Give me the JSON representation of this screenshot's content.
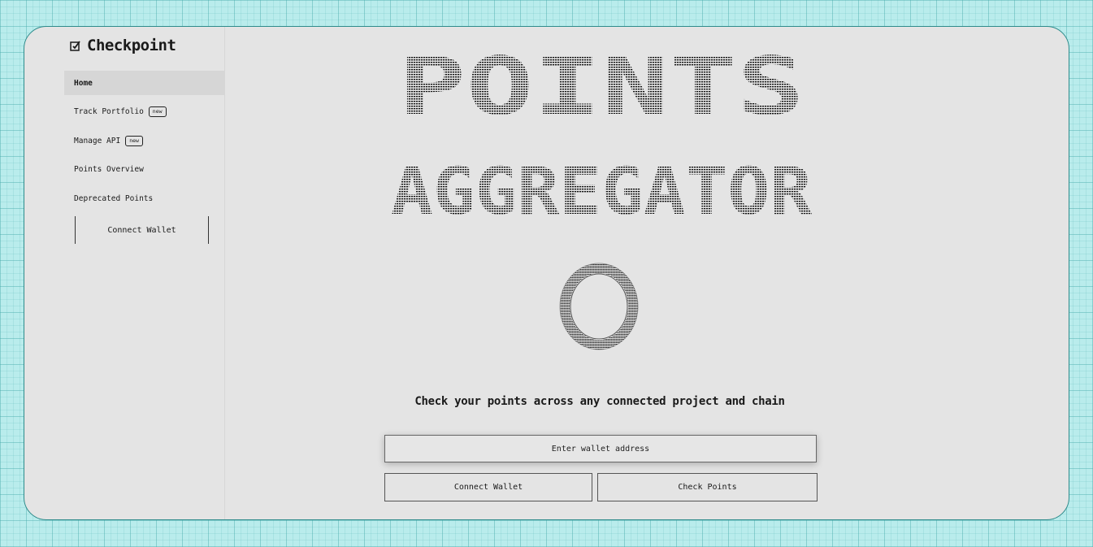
{
  "brand": {
    "name": "Checkpoint",
    "icon": "checkpoint-logo-icon"
  },
  "sidebar": {
    "items": [
      {
        "label": "Home",
        "active": true,
        "badge": ""
      },
      {
        "label": "Track Portfolio",
        "active": false,
        "badge": "new"
      },
      {
        "label": "Manage API",
        "active": false,
        "badge": "new"
      },
      {
        "label": "Points Overview",
        "active": false,
        "badge": ""
      },
      {
        "label": "Deprecated Points",
        "active": false,
        "badge": ""
      }
    ],
    "connect_label": "Connect Wallet"
  },
  "hero": {
    "art_words": [
      "POINTS",
      "AGGREGATOR"
    ],
    "tagline": "Check your points across any connected project and chain"
  },
  "search": {
    "placeholder": "Enter wallet address",
    "value": ""
  },
  "actions": {
    "connect_label": "Connect Wallet",
    "check_label": "Check Points"
  },
  "colors": {
    "background": "#b9ecec",
    "frame": "#e4e4e4",
    "border": "#2e8b8b",
    "text": "#1a1a1a"
  }
}
